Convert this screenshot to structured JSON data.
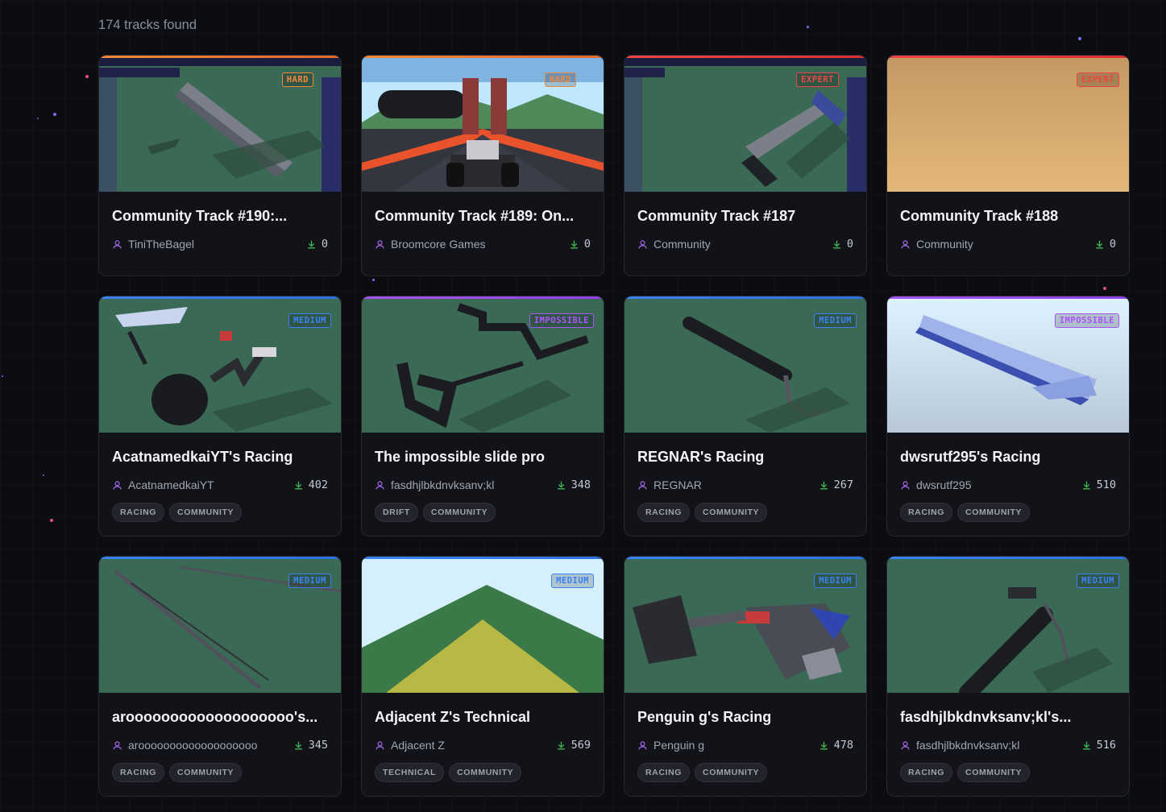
{
  "results": {
    "count_text": "174 tracks found"
  },
  "colors": {
    "hard": "#f0883e",
    "expert": "#ef4444",
    "medium": "#3b82f6",
    "impossible": "#a855f7",
    "user_icon": "#a66bf0",
    "download_icon": "#3fb950"
  },
  "cards": [
    {
      "title": "Community Track #190:...",
      "author": "TiniTheBagel",
      "downloads": "0",
      "difficulty": "HARD",
      "tags": []
    },
    {
      "title": "Community Track #189: On...",
      "author": "Broomcore Games",
      "downloads": "0",
      "difficulty": "HARD",
      "tags": []
    },
    {
      "title": "Community Track #187",
      "author": "Community",
      "downloads": "0",
      "difficulty": "EXPERT",
      "tags": []
    },
    {
      "title": "Community Track #188",
      "author": "Community",
      "downloads": "0",
      "difficulty": "EXPERT",
      "tags": []
    },
    {
      "title": "AcatnamedkaiYT's Racing",
      "author": "AcatnamedkaiYT",
      "downloads": "402",
      "difficulty": "MEDIUM",
      "tags": [
        "RACING",
        "COMMUNITY"
      ]
    },
    {
      "title": "The impossible slide pro",
      "author": "fasdhjlbkdnvksanv;kl",
      "downloads": "348",
      "difficulty": "IMPOSSIBLE",
      "tags": [
        "DRIFT",
        "COMMUNITY"
      ]
    },
    {
      "title": "REGNAR's Racing",
      "author": "REGNAR",
      "downloads": "267",
      "difficulty": "MEDIUM",
      "tags": [
        "RACING",
        "COMMUNITY"
      ]
    },
    {
      "title": "dwsrutf295's Racing",
      "author": "dwsrutf295",
      "downloads": "510",
      "difficulty": "IMPOSSIBLE",
      "tags": [
        "RACING",
        "COMMUNITY"
      ]
    },
    {
      "title": "arooooooooooooooooooo's...",
      "author": "arooooooooooooooooooo",
      "downloads": "345",
      "difficulty": "MEDIUM",
      "tags": [
        "RACING",
        "COMMUNITY"
      ]
    },
    {
      "title": "Adjacent Z's Technical",
      "author": "Adjacent Z",
      "downloads": "569",
      "difficulty": "MEDIUM",
      "tags": [
        "TECHNICAL",
        "COMMUNITY"
      ]
    },
    {
      "title": "Penguin g's Racing",
      "author": "Penguin g",
      "downloads": "478",
      "difficulty": "MEDIUM",
      "tags": [
        "RACING",
        "COMMUNITY"
      ]
    },
    {
      "title": "fasdhjlbkdnvksanv;kl's...",
      "author": "fasdhjlbkdnvksanv;kl",
      "downloads": "516",
      "difficulty": "MEDIUM",
      "tags": [
        "RACING",
        "COMMUNITY"
      ]
    }
  ]
}
